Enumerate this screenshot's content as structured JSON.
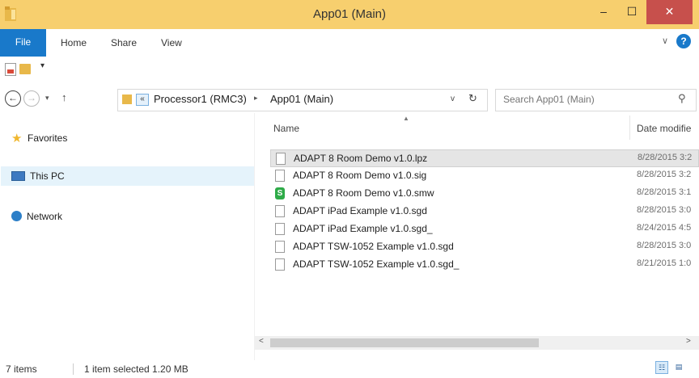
{
  "window": {
    "title": "App01 (Main)",
    "minimize": "–",
    "maximize": "☐",
    "close": "✕"
  },
  "ribbon": {
    "tabs": [
      {
        "label": "File"
      },
      {
        "label": "Home"
      },
      {
        "label": "Share"
      },
      {
        "label": "View"
      }
    ],
    "collapse_icon": "chevron-down-icon",
    "help": "?"
  },
  "quick_access": {
    "items": [
      "properties-icon",
      "new-folder-icon"
    ],
    "dropdown": "▾"
  },
  "navigation": {
    "back": "←",
    "forward": "→",
    "recent": "▾",
    "up": "↑"
  },
  "address": {
    "overflow": "«",
    "breadcrumb": [
      {
        "label": "Processor1 (RMC3)"
      },
      {
        "label": "App01 (Main)"
      }
    ],
    "separator": "▸",
    "dropdown": "v",
    "refresh": "↻"
  },
  "search": {
    "placeholder": "Search App01 (Main)",
    "icon": "search-icon"
  },
  "nav_pane": {
    "items": [
      {
        "label": "Favorites",
        "icon": "star-icon"
      },
      {
        "label": "This PC",
        "icon": "computer-icon",
        "selected": true
      },
      {
        "label": "Network",
        "icon": "network-icon"
      }
    ]
  },
  "file_list": {
    "columns": [
      {
        "label": "Name"
      },
      {
        "label": "Date modifie"
      }
    ],
    "sort_indicator": "▲",
    "rows": [
      {
        "name": "ADAPT 8 Room Demo v1.0.lpz",
        "date": "8/28/2015 3:2",
        "icon": "file-icon",
        "selected": true
      },
      {
        "name": "ADAPT 8 Room Demo v1.0.sig",
        "date": "8/28/2015 3:2",
        "icon": "file-icon"
      },
      {
        "name": "ADAPT 8 Room Demo v1.0.smw",
        "date": "8/28/2015 3:1",
        "icon": "simpl-file-icon",
        "icon_letter": "S"
      },
      {
        "name": "ADAPT iPad Example v1.0.sgd",
        "date": "8/28/2015 3:0",
        "icon": "file-icon"
      },
      {
        "name": "ADAPT iPad Example v1.0.sgd_",
        "date": "8/24/2015 4:5",
        "icon": "file-icon"
      },
      {
        "name": "ADAPT TSW-1052 Example v1.0.sgd",
        "date": "8/28/2015 3:0",
        "icon": "file-icon"
      },
      {
        "name": "ADAPT TSW-1052 Example v1.0.sgd_",
        "date": "8/21/2015 1:0",
        "icon": "file-icon"
      }
    ]
  },
  "scrollbar": {
    "left": "<",
    "right": ">"
  },
  "status": {
    "item_count": "7 items",
    "selection": "1 item selected  1.20 MB",
    "view_details": "☷",
    "view_tiles": "▤"
  },
  "colors": {
    "title_bar": "#f7cf6e",
    "file_tab": "#1979ca",
    "close_button": "#c7504c",
    "selection": "#e5f3fb"
  }
}
